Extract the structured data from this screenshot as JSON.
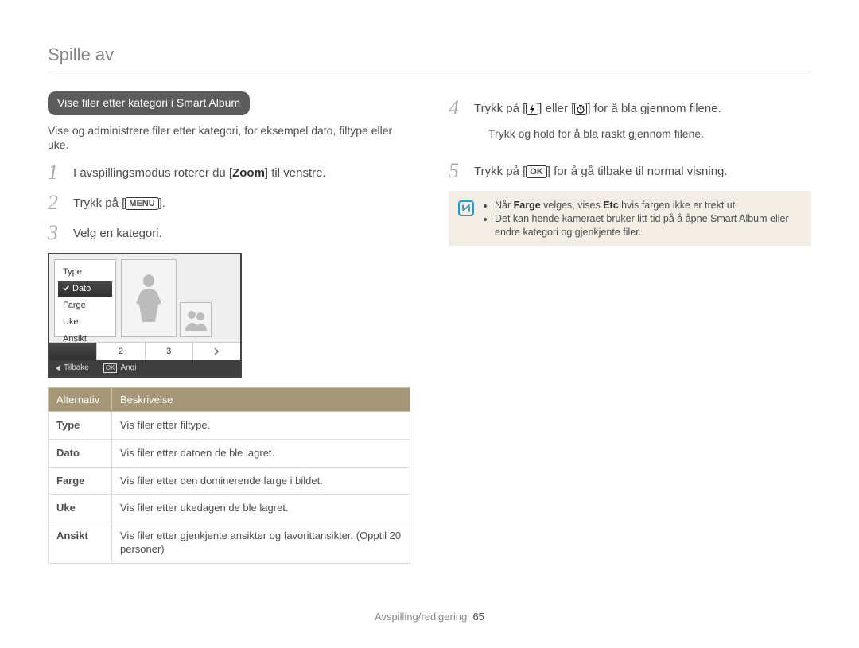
{
  "section_title": "Spille av",
  "left": {
    "pill": "Vise filer etter kategori i Smart Album",
    "intro": "Vise og administrere filer etter kategori, for eksempel dato, filtype eller uke.",
    "steps": {
      "num1": "1",
      "s1_pre": "I avspillingsmodus roterer du [",
      "s1_bold": "Zoom",
      "s1_post": "] til venstre.",
      "num2": "2",
      "s2_pre": "Trykk på [",
      "s2_menu": "MENU",
      "s2_post": "].",
      "num3": "3",
      "s3": "Velg en kategori."
    },
    "mock": {
      "menu_items": [
        "Type",
        "Dato",
        "Farge",
        "Uke",
        "Ansikt"
      ],
      "selected_index": 1,
      "strip_cells": [
        "",
        "2",
        "3",
        ""
      ],
      "footer_back": "Tilbake",
      "footer_set": "Angi"
    },
    "table": {
      "head_a": "Alternativ",
      "head_b": "Beskrivelse",
      "rows": [
        {
          "k": "Type",
          "v": "Vis filer etter filtype."
        },
        {
          "k": "Dato",
          "v": "Vis filer etter datoen de ble lagret."
        },
        {
          "k": "Farge",
          "v": "Vis filer etter den dominerende farge i bildet."
        },
        {
          "k": "Uke",
          "v": "Vis filer etter ukedagen de ble lagret."
        },
        {
          "k": "Ansikt",
          "v": "Vis filer etter gjenkjente ansikter og favorittansikter. (Opptil 20 personer)"
        }
      ]
    }
  },
  "right": {
    "steps": {
      "num4": "4",
      "s4_pre": "Trykk på [",
      "s4_mid": "] eller [",
      "s4_post": "] for å bla gjennom filene.",
      "s4_bullet": "Trykk og hold for å bla raskt gjennom filene.",
      "num5": "5",
      "s5_pre": "Trykk på [",
      "s5_ok": "OK",
      "s5_post": "] for å gå tilbake til normal visning."
    },
    "note": {
      "line1_pre": "Når ",
      "line1_bold1": "Farge",
      "line1_mid": " velges, vises ",
      "line1_bold2": "Etc",
      "line1_post": " hvis fargen ikke er trekt ut.",
      "line2": "Det kan hende kameraet bruker litt tid på å åpne Smart Album eller endre kategori og gjenkjente filer."
    }
  },
  "footer": {
    "label": "Avspilling/redigering",
    "page": "65"
  }
}
